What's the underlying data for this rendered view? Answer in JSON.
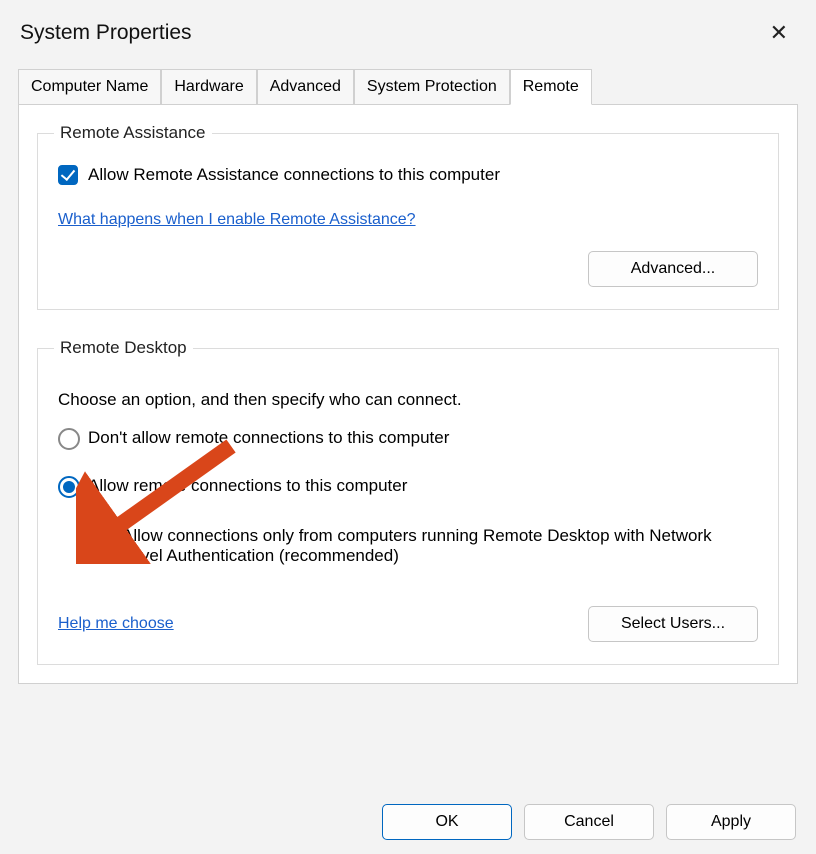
{
  "window": {
    "title": "System Properties",
    "close_symbol": "✕"
  },
  "tabs": [
    {
      "label": "Computer Name"
    },
    {
      "label": "Hardware"
    },
    {
      "label": "Advanced"
    },
    {
      "label": "System Protection"
    },
    {
      "label": "Remote",
      "active": true
    }
  ],
  "remote_assistance": {
    "legend": "Remote Assistance",
    "allow_checkbox_label": "Allow Remote Assistance connections to this computer",
    "allow_checked": true,
    "help_link": "What happens when I enable Remote Assistance?",
    "advanced_button": "Advanced..."
  },
  "remote_desktop": {
    "legend": "Remote Desktop",
    "instruction": "Choose an option, and then specify who can connect.",
    "radio_dont_allow": "Don't allow remote connections to this computer",
    "radio_allow": "Allow remote connections to this computer",
    "selected": "allow",
    "nla_checkbox_label": "Allow connections only from computers running Remote Desktop with Network Level Authentication (recommended)",
    "nla_checked": true,
    "help_link": "Help me choose",
    "select_users_button": "Select Users..."
  },
  "dialog_buttons": {
    "ok": "OK",
    "cancel": "Cancel",
    "apply": "Apply"
  },
  "annotation": {
    "arrow_color": "#d9461a"
  }
}
